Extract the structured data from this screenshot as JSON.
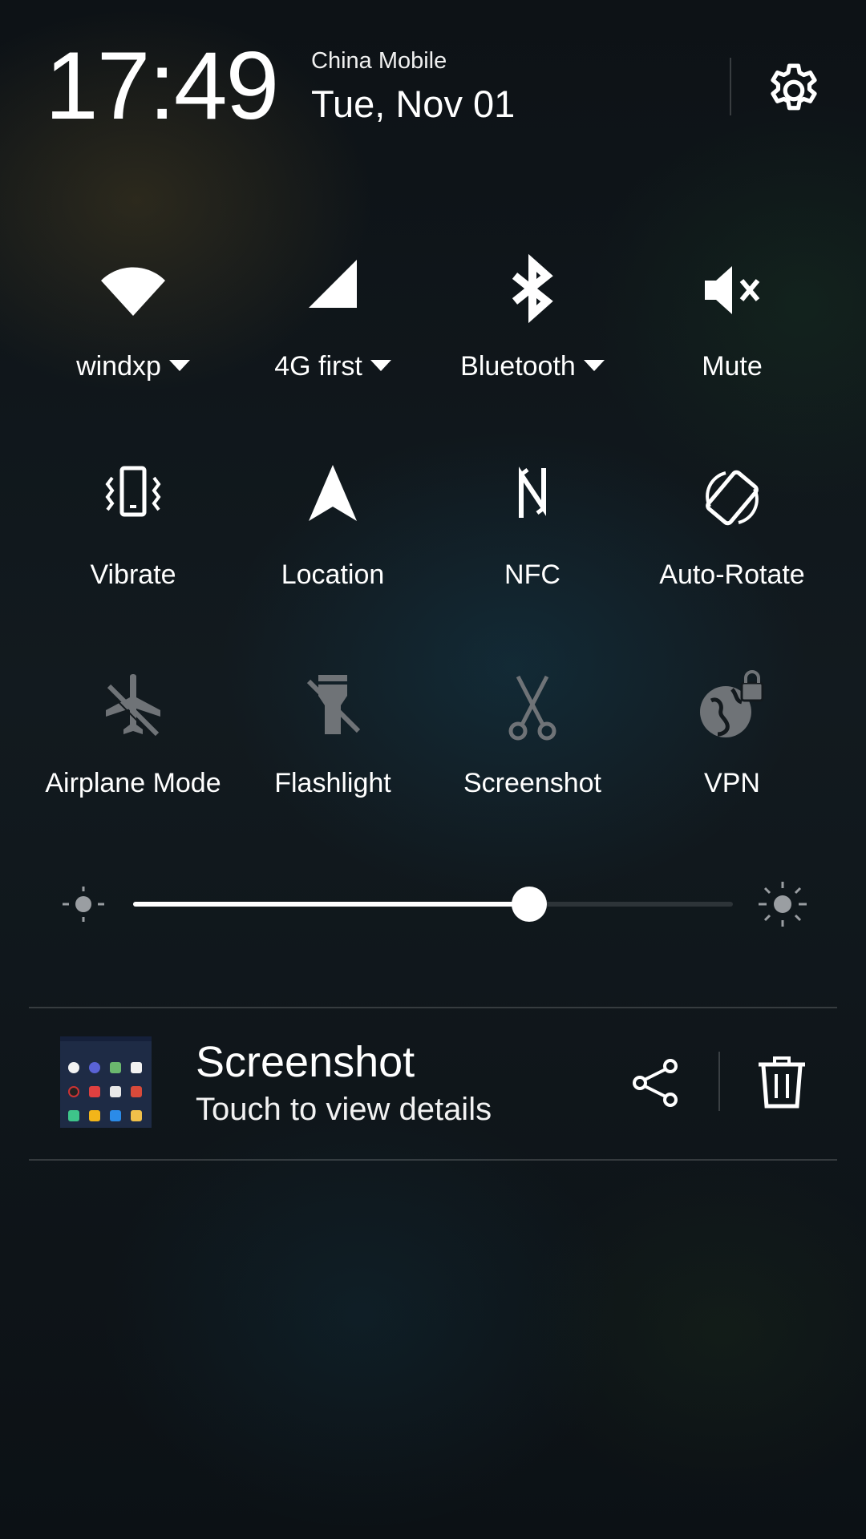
{
  "header": {
    "time": "17:49",
    "carrier": "China Mobile",
    "date": "Tue, Nov 01"
  },
  "tiles": [
    {
      "label": "windxp",
      "icon": "wifi-icon",
      "dropdown": true,
      "active": true
    },
    {
      "label": "4G first",
      "icon": "cellular-signal-icon",
      "dropdown": true,
      "active": true
    },
    {
      "label": "Bluetooth",
      "icon": "bluetooth-icon",
      "dropdown": true,
      "active": true
    },
    {
      "label": "Mute",
      "icon": "mute-icon",
      "dropdown": false,
      "active": true
    },
    {
      "label": "Vibrate",
      "icon": "vibrate-icon",
      "dropdown": false,
      "active": true
    },
    {
      "label": "Location",
      "icon": "location-icon",
      "dropdown": false,
      "active": true
    },
    {
      "label": "NFC",
      "icon": "nfc-icon",
      "dropdown": false,
      "active": true
    },
    {
      "label": "Auto-Rotate",
      "icon": "auto-rotate-icon",
      "dropdown": false,
      "active": true
    },
    {
      "label": "Airplane Mode",
      "icon": "airplane-off-icon",
      "dropdown": false,
      "active": false
    },
    {
      "label": "Flashlight",
      "icon": "flashlight-off-icon",
      "dropdown": false,
      "active": false
    },
    {
      "label": "Screenshot",
      "icon": "scissors-icon",
      "dropdown": false,
      "active": false
    },
    {
      "label": "VPN",
      "icon": "vpn-globe-lock-icon",
      "dropdown": false,
      "active": false
    }
  ],
  "brightness": {
    "level": 0.66
  },
  "notification": {
    "title": "Screenshot",
    "subtitle": "Touch to view details",
    "actions": [
      "share-icon",
      "trash-icon"
    ]
  },
  "colors": {
    "active_icon": "#ffffff",
    "inactive_icon": "#6f7377",
    "background": "#0e1418"
  }
}
